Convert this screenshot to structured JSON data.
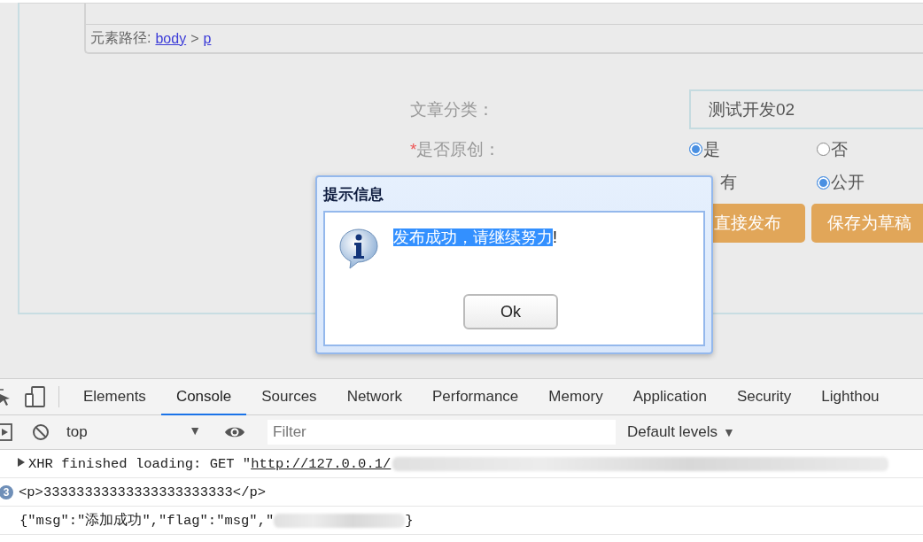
{
  "editor": {
    "path_label": "元素路径:",
    "path_links": [
      "body",
      "p"
    ],
    "path_separator": ">"
  },
  "form": {
    "category": {
      "label": "文章分类：",
      "value": "测试开发02"
    },
    "original": {
      "required_mark": "*",
      "label": "是否原创：",
      "options": [
        {
          "label": "是",
          "selected": true
        },
        {
          "label": "否",
          "selected": false
        }
      ]
    },
    "visibility": {
      "options": [
        {
          "label": "有"
        },
        {
          "label": "公开",
          "selected": true
        }
      ]
    },
    "buttons": [
      "直接发布",
      "保存为草稿"
    ]
  },
  "dialog": {
    "title": "提示信息",
    "message": [
      {
        "text": "发布成功，请继续努力",
        "highlighted": true
      },
      {
        "text": "!",
        "highlighted": false
      }
    ],
    "button": "Ok"
  },
  "devtools": {
    "tabs": [
      {
        "label": "Elements",
        "selected": false
      },
      {
        "label": "Console",
        "selected": true
      },
      {
        "label": "Sources",
        "selected": false
      },
      {
        "label": "Network",
        "selected": false
      },
      {
        "label": "Performance",
        "selected": false
      },
      {
        "label": "Memory",
        "selected": false
      },
      {
        "label": "Application",
        "selected": false
      },
      {
        "label": "Security",
        "selected": false
      },
      {
        "label": "Lighthou",
        "selected": false
      }
    ],
    "context": "top",
    "context_arrow": "▼",
    "filter": {
      "placeholder": "Filter"
    },
    "levels": "Default levels",
    "levels_arrow": "▼",
    "console": [
      {
        "kind": "xhr",
        "text": "XHR finished loading: GET \"",
        "link": "http://127.0.0.1/"
      },
      {
        "kind": "repeat",
        "count": "3",
        "text": "<p>33333333333333333333333</p>"
      },
      {
        "kind": "object",
        "text": "{\"msg\":\"添加成功\",\"flag\":\"msg\",\"",
        "end": "}"
      }
    ]
  }
}
